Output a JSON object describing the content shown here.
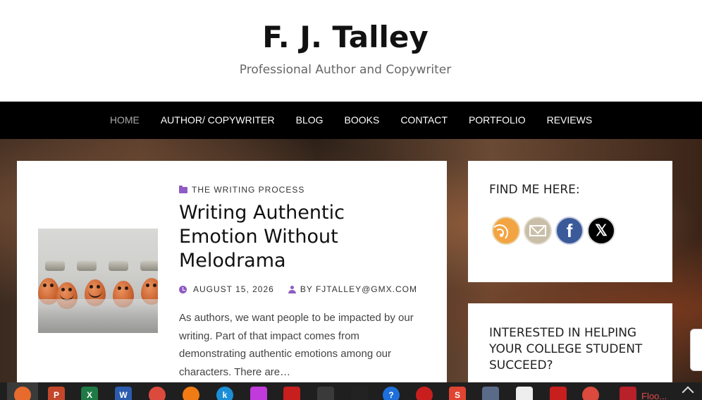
{
  "site": {
    "title": "F. J. Talley",
    "tagline": "Professional Author and Copywriter"
  },
  "nav": {
    "items": [
      {
        "label": "HOME",
        "active": true
      },
      {
        "label": "AUTHOR/ COPYWRITER",
        "active": false
      },
      {
        "label": "BLOG",
        "active": false
      },
      {
        "label": "BOOKS",
        "active": false
      },
      {
        "label": "CONTACT",
        "active": false
      },
      {
        "label": "PORTFOLIO",
        "active": false
      },
      {
        "label": "REVIEWS",
        "active": false
      }
    ]
  },
  "post": {
    "category": "THE WRITING PROCESS",
    "title": "Writing Authentic Emotion Without Melodrama",
    "date": "AUGUST 15, 2026",
    "author": "BY FJTALLEY@GMX.COM",
    "excerpt": "As authors, we want people to be impacted by our writing. Part of that impact comes from demonstrating authentic emotions among our characters. There are…",
    "thumbnail_icon": "eggs-with-faces-image"
  },
  "sidebar": {
    "find_me_title": "FIND ME HERE:",
    "social_icons": [
      "rss-icon",
      "email-icon",
      "facebook-icon",
      "x-twitter-icon"
    ],
    "facebook_glyph": "f",
    "x_glyph": "𝕏",
    "widget2_title": "INTERESTED IN HELPING YOUR COLLEGE STUDENT SUCCEED?"
  },
  "taskbar": {
    "pinned_icons": [
      "firefox-icon",
      "powerpoint-icon",
      "excel-icon",
      "word-icon",
      "chrome-icon",
      "audible-icon",
      "kindle-icon",
      "paint-icon",
      "acrobat-icon",
      "calculator-icon",
      "media-icon",
      "help-icon",
      "record-icon",
      "s-app-icon",
      "rocket-icon",
      "notepad-icon",
      "acrobat-icon-2",
      "chrome-icon-2",
      "flood-app-icon"
    ],
    "glyphs": [
      "",
      "P",
      "X",
      "W",
      "",
      "",
      "k",
      "",
      "",
      "",
      "",
      "?",
      "",
      "S",
      "",
      "",
      "",
      "",
      ""
    ],
    "open_app_label": "Floo..."
  },
  "colors": {
    "accent": "#8e5cc4",
    "nav_bg": "#000000",
    "taskbar_bg": "#1f1f1f"
  }
}
